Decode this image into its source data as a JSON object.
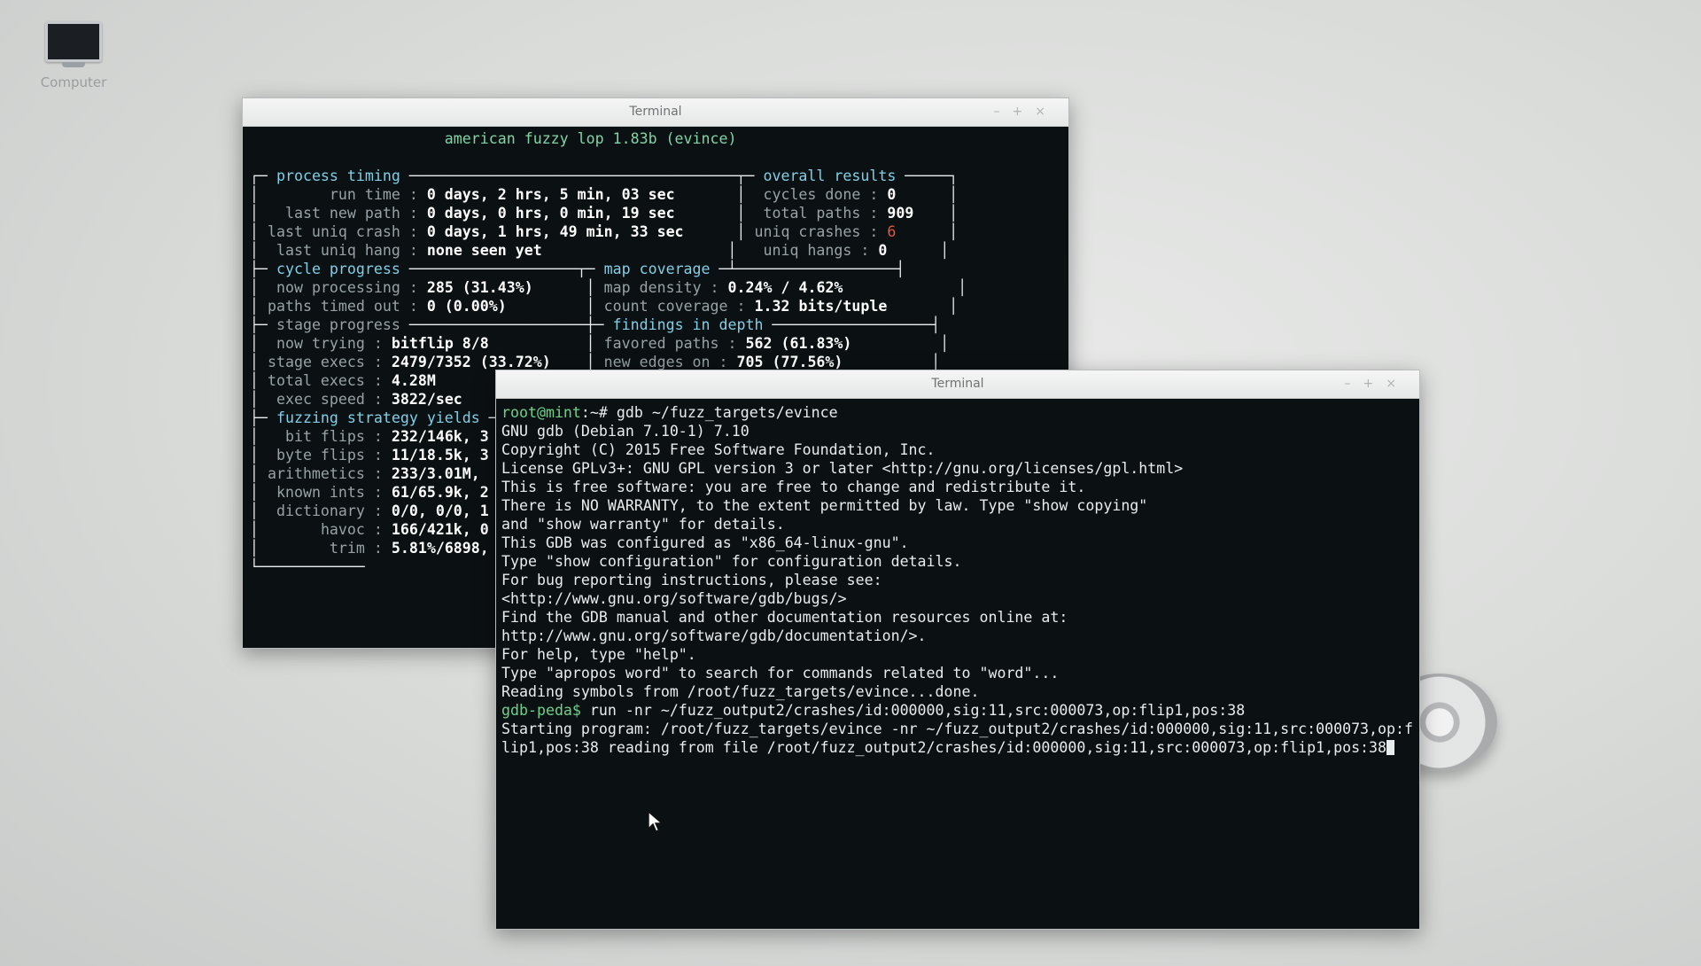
{
  "desktop": {
    "icon_label": "Computer",
    "icon_name": "computer-icon"
  },
  "afl_window": {
    "title": "Terminal",
    "controls": [
      "–",
      "+",
      "×"
    ],
    "banner": "american fuzzy lop 1.83b (evince)",
    "process_timing": {
      "header": "process timing",
      "run_time": "0 days, 2 hrs, 5 min, 03 sec",
      "last_new_path": "0 days, 0 hrs, 0 min, 19 sec",
      "last_uniq_crash": "0 days, 1 hrs, 49 min, 33 sec",
      "last_uniq_hang": "none seen yet"
    },
    "overall_results": {
      "header": "overall results",
      "cycles_done": "0",
      "total_paths": "909",
      "uniq_crashes": "6",
      "uniq_hangs": "0"
    },
    "cycle_progress": {
      "header": "cycle progress",
      "now_processing": "285 (31.43%)",
      "paths_timed_out": "0 (0.00%)"
    },
    "map_coverage": {
      "header": "map coverage",
      "map_density": "0.24% / 4.62%",
      "count_coverage": "1.32 bits/tuple"
    },
    "stage_progress": {
      "header": "stage progress",
      "now_trying": "bitflip 8/8",
      "stage_execs": "2479/7352 (33.72%)",
      "total_execs": "4.28M",
      "exec_speed": "3822/sec"
    },
    "findings_in_depth": {
      "header": "findings in depth",
      "favored_paths": "562 (61.83%)",
      "new_edges_on": "705 (77.56%)"
    },
    "fuzzing_strategy_yields": {
      "header": "fuzzing strategy yields",
      "bit_flips": "232/146k, 3",
      "byte_flips": "11/18.5k, 3",
      "arithmetics": "233/3.01M,",
      "known_ints": "61/65.9k, 2",
      "dictionary": "0/0, 0/0, 1",
      "havoc": "166/421k, 0",
      "trim": "5.81%/6898,"
    }
  },
  "gdb_window": {
    "title": "Terminal",
    "controls": [
      "–",
      "+",
      "×"
    ],
    "prompt_root": "root@mint",
    "prompt_root_suffix": ":~# ",
    "cmd1": "gdb ~/fuzz_targets/evince",
    "lines": [
      "GNU gdb (Debian 7.10-1) 7.10",
      "Copyright (C) 2015 Free Software Foundation, Inc.",
      "License GPLv3+: GNU GPL version 3 or later <http://gnu.org/licenses/gpl.html>",
      "This is free software: you are free to change and redistribute it.",
      "There is NO WARRANTY, to the extent permitted by law. Type \"show copying\"",
      "and \"show warranty\" for details.",
      "This GDB was configured as \"x86_64-linux-gnu\".",
      "Type \"show configuration\" for configuration details.",
      "For bug reporting instructions, please see:",
      "<http://www.gnu.org/software/gdb/bugs/>",
      "Find the GDB manual and other documentation resources online at:",
      "http://www.gnu.org/software/gdb/documentation/>.",
      "For help, type \"help\".",
      "Type \"apropos word\" to search for commands related to \"word\"...",
      "Reading symbols from /root/fuzz_targets/evince...done."
    ],
    "prompt_peda": "gdb-peda$ ",
    "cmd2": "run -nr ~/fuzz_output2/crashes/id:000000,sig:11,src:000073,op:flip1,pos:38",
    "out1": "Starting program: /root/fuzz_targets/evince -nr ~/fuzz_output2/crashes/id:000000,sig:11,src:000073,op:f",
    "out2": "lip1,pos:38 reading from file /root/fuzz_output2/crashes/id:000000,sig:11,src:000073,op:flip1,pos:38"
  },
  "colors": {
    "terminal_bg": "#0b1013",
    "accent_cyan": "#7fd0e8",
    "crash_red": "#e0573f",
    "prompt_green": "#6fd08a"
  }
}
